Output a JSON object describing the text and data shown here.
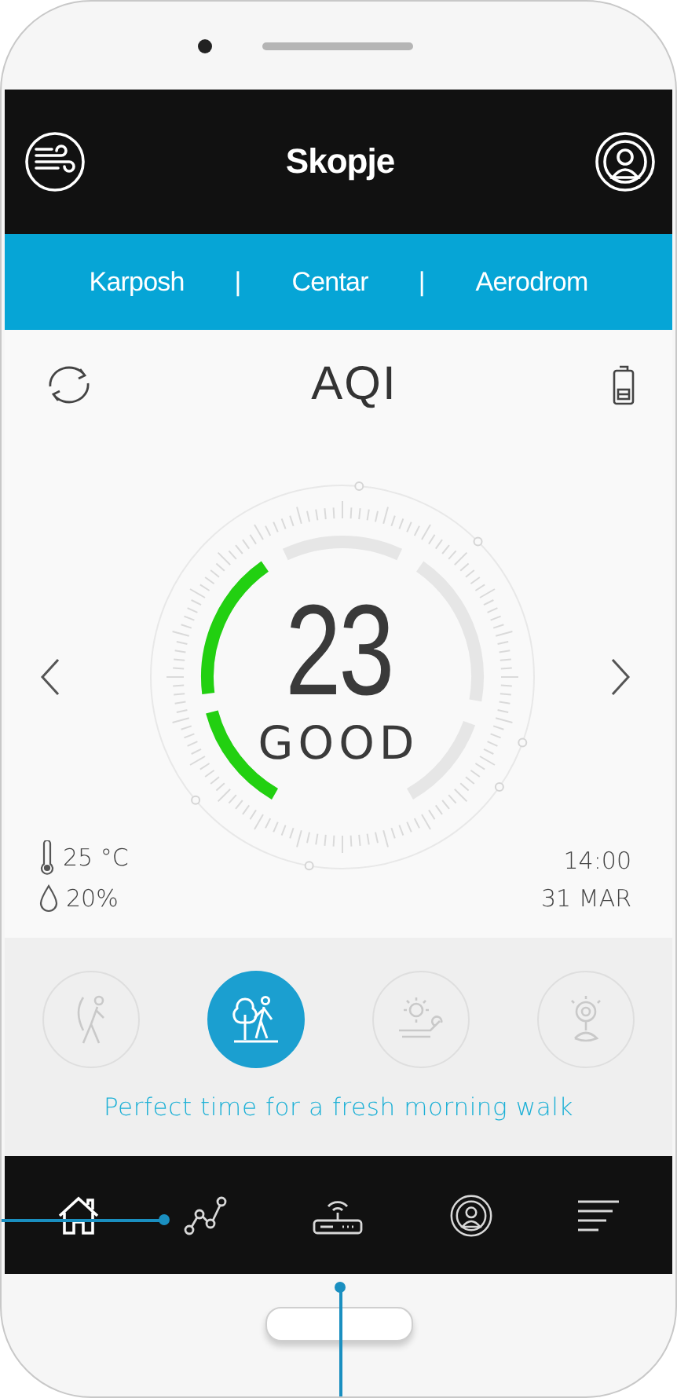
{
  "header": {
    "title": "Skopje"
  },
  "districts": [
    {
      "kind": "tab",
      "label": "Karposh"
    },
    {
      "kind": "separator",
      "label": "|"
    },
    {
      "kind": "tab",
      "label": "Centar"
    },
    {
      "kind": "separator",
      "label": "|"
    },
    {
      "kind": "tab",
      "label": "Aerodrom"
    }
  ],
  "aqi": {
    "title": "AQI",
    "value": "23",
    "status": "GOOD"
  },
  "weather": {
    "temperature": "25 °C",
    "humidity": "20%"
  },
  "clock": {
    "time": "14:00",
    "date": "31 MAR"
  },
  "activities": [
    {
      "kind": "stretch",
      "selected": false
    },
    {
      "kind": "walk",
      "selected": true
    },
    {
      "kind": "sunbathe",
      "selected": false
    },
    {
      "kind": "meditate",
      "selected": false
    }
  ],
  "tip": "Perfect time for a fresh morning walk",
  "nav": [
    {
      "kind": "home",
      "selected": true
    },
    {
      "kind": "chart",
      "selected": false
    },
    {
      "kind": "router",
      "selected": false
    },
    {
      "kind": "broadcast",
      "selected": false
    },
    {
      "kind": "menu",
      "selected": false
    }
  ]
}
